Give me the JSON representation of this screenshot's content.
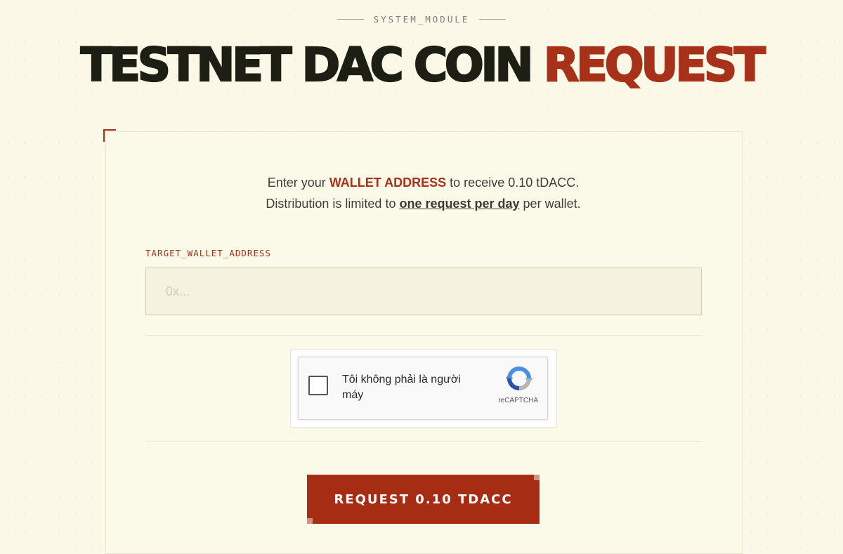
{
  "header": {
    "module_tag": "SYSTEM_MODULE",
    "title_main": "TESTNET DAC COIN",
    "title_accent": "REQUEST"
  },
  "intro": {
    "line1_prefix": "Enter your",
    "line1_highlight": "WALLET ADDRESS",
    "line1_suffix": "to receive 0.10 tDACC.",
    "line2_prefix": "Distribution is limited to",
    "line2_highlight": "one request per day",
    "line2_suffix": "per wallet."
  },
  "form": {
    "address_label": "TARGET_WALLET_ADDRESS",
    "address_value": "",
    "address_placeholder": "0x..."
  },
  "captcha": {
    "label": "Tôi không phải là người máy",
    "brand": "reCAPTCHA",
    "checked": false
  },
  "submit": {
    "label": "REQUEST 0.10 TDACC"
  },
  "colors": {
    "accent": "#a8311a",
    "background": "#fbf8e7",
    "heading": "#1d1f15"
  }
}
